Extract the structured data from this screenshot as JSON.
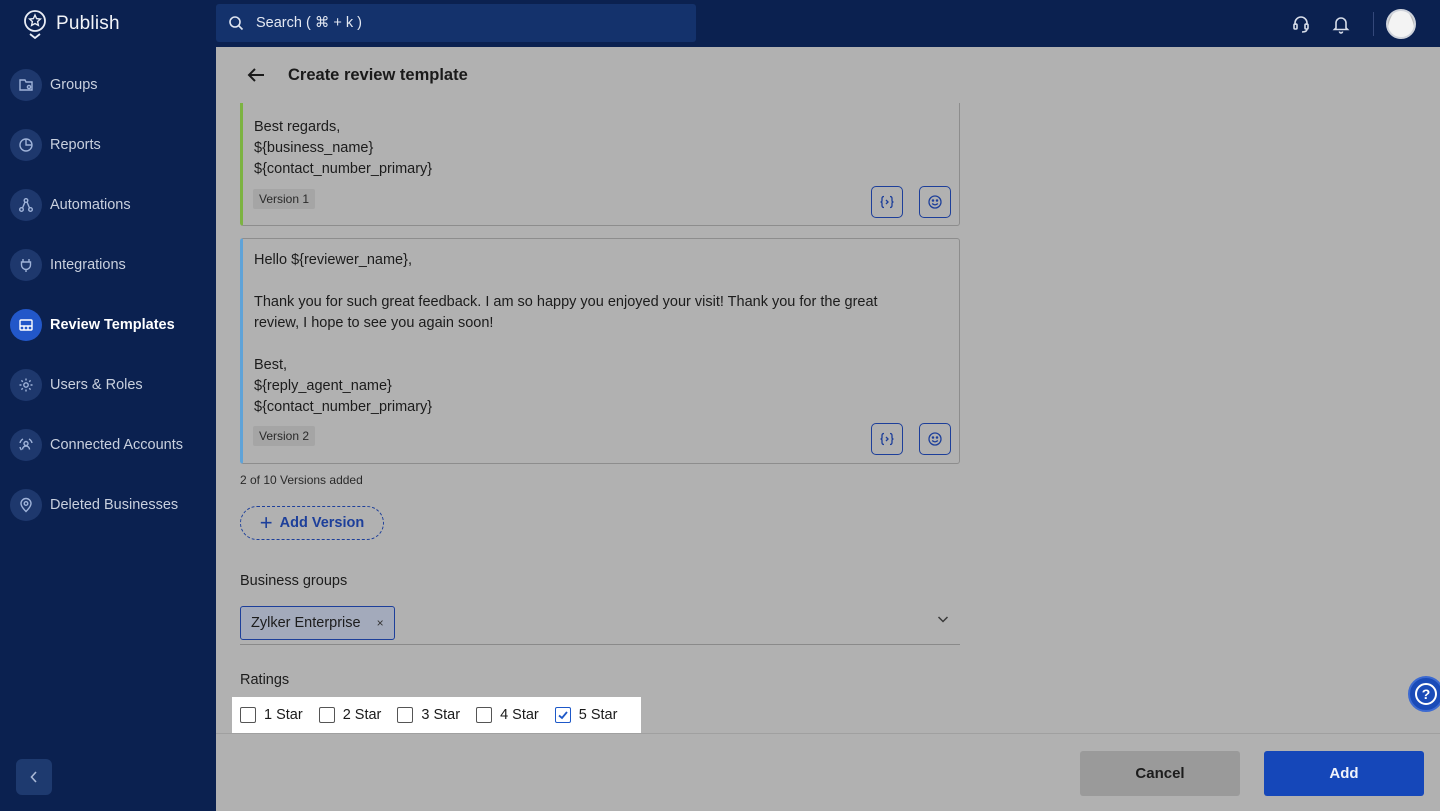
{
  "app": {
    "name": "Publish"
  },
  "search": {
    "placeholder": "Search ( ⌘ + k )"
  },
  "sidebar": {
    "items": [
      {
        "label": "Groups",
        "icon": "groups-icon"
      },
      {
        "label": "Reports",
        "icon": "reports-icon"
      },
      {
        "label": "Automations",
        "icon": "automations-icon"
      },
      {
        "label": "Integrations",
        "icon": "integrations-icon"
      },
      {
        "label": "Review Templates",
        "icon": "review-templates-icon",
        "active": true
      },
      {
        "label": "Users & Roles",
        "icon": "users-roles-icon"
      },
      {
        "label": "Connected Accounts",
        "icon": "connected-accounts-icon"
      },
      {
        "label": "Deleted Businesses",
        "icon": "deleted-businesses-icon"
      }
    ]
  },
  "page": {
    "title": "Create review template"
  },
  "versions": [
    {
      "text": "Best regards,\n${business_name}\n${contact_number_primary}",
      "badge": "Version 1",
      "accent": "#7cb342"
    },
    {
      "text": "Hello ${reviewer_name},\n\nThank you for such great feedback. I am so happy you enjoyed your visit! Thank you for the great\nreview, I hope to see you again soon!\n\nBest,\n${reply_agent_name}\n${contact_number_primary}",
      "badge": "Version 2",
      "accent": "#5fa3d8"
    }
  ],
  "versions_count": "2 of 10 Versions added",
  "add_version_label": "Add Version",
  "business_groups": {
    "label": "Business groups",
    "selected": [
      "Zylker Enterprise"
    ],
    "chip_remove": "×"
  },
  "ratings": {
    "label": "Ratings",
    "options": [
      {
        "label": "1 Star",
        "checked": false
      },
      {
        "label": "2 Star",
        "checked": false
      },
      {
        "label": "3 Star",
        "checked": false
      },
      {
        "label": "4 Star",
        "checked": false
      },
      {
        "label": "5 Star",
        "checked": true
      }
    ]
  },
  "footer": {
    "cancel_label": "Cancel",
    "add_label": "Add"
  },
  "help": {
    "label": "?"
  },
  "colors": {
    "primary": "#1547b9",
    "sidebar": "#0b2150",
    "accent_blue": "#1d3f9a"
  }
}
